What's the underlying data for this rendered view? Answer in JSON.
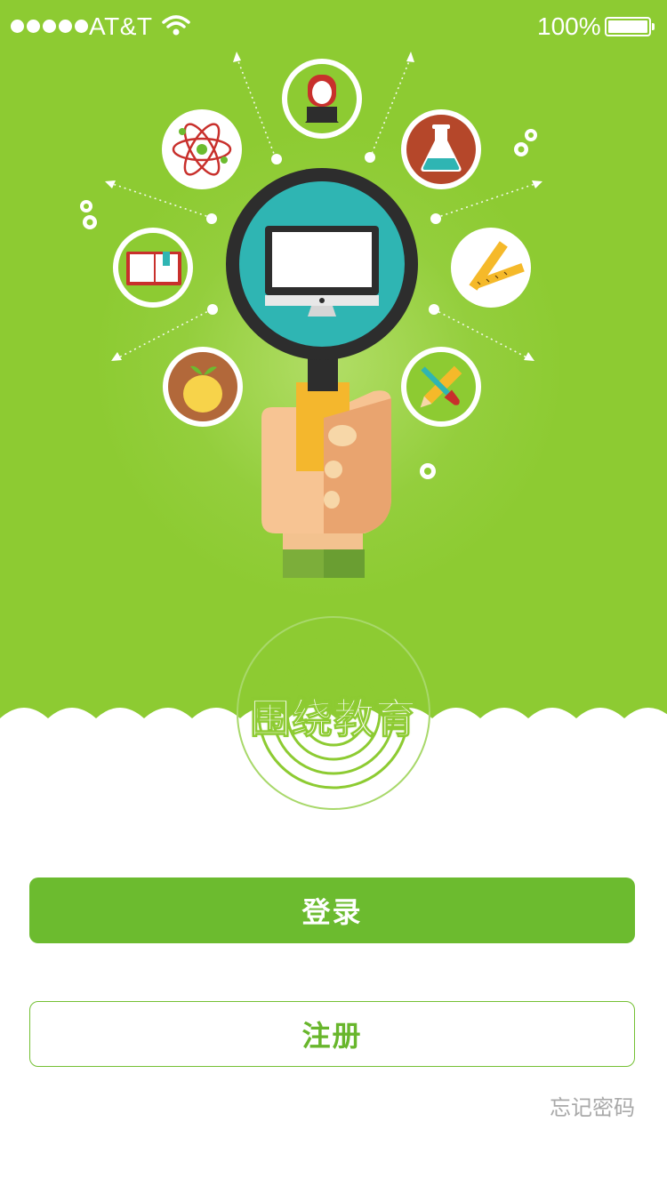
{
  "status_bar": {
    "carrier": "AT&T",
    "battery_percent": "100%",
    "signal_bars": 5
  },
  "hero": {
    "background_color": "#8dcb32",
    "icons": [
      "teacher-icon",
      "atom-icon",
      "flask-icon",
      "book-icon",
      "ruler-icon",
      "apple-icon",
      "pencil-brush-icon",
      "magnifier-monitor-icon",
      "gear-icon"
    ]
  },
  "brand": {
    "name": "围绕教育"
  },
  "actions": {
    "login_label": "登录",
    "register_label": "注册",
    "forgot_label": "忘记密码"
  },
  "colors": {
    "primary": "#6cbb2f",
    "secondary_text": "#a9a9a9"
  }
}
